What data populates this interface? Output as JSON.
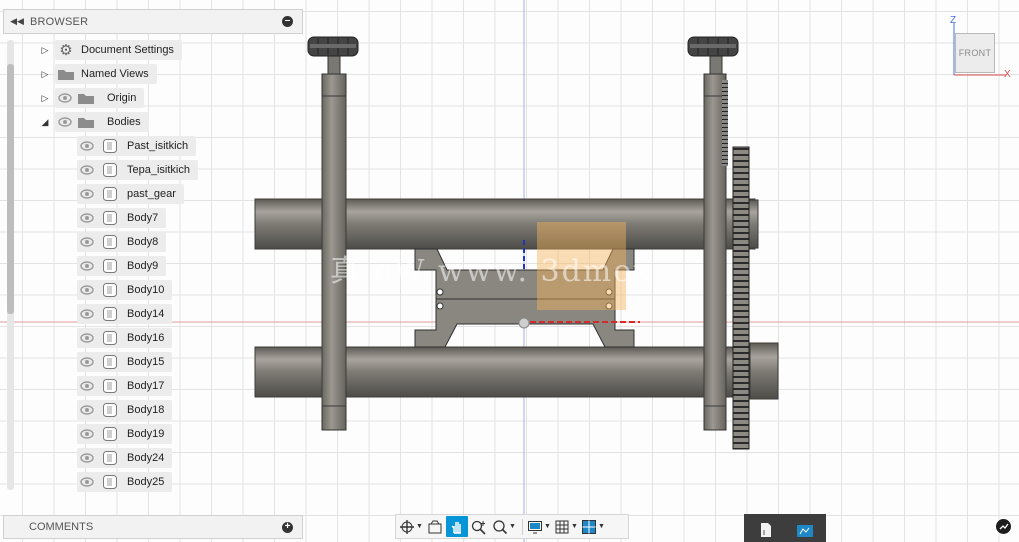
{
  "browser": {
    "title": "BROWSER",
    "items": [
      {
        "label": "Document Settings",
        "expand": "▷",
        "icon": "gear-icon"
      },
      {
        "label": "Named Views",
        "expand": "▷",
        "icon": "folder-icon"
      },
      {
        "label": "Origin",
        "expand": "▷",
        "icon": "folder-icon",
        "visible": true
      },
      {
        "label": "Bodies",
        "expand": "◢",
        "icon": "folder-icon",
        "visible": true
      }
    ],
    "bodies": [
      "Past_isitkich",
      "Tepa_isitkich",
      "past_gear",
      "Body7",
      "Body8",
      "Body9",
      "Body10",
      "Body14",
      "Body16",
      "Body15",
      "Body17",
      "Body18",
      "Body19",
      "Body24",
      "Body25"
    ]
  },
  "comments": {
    "title": "COMMENTS"
  },
  "viewcube": {
    "face": "FRONT",
    "z": "Z",
    "x": "X"
  },
  "watermark": "真  oW www. 3dmox",
  "toolbar": {
    "tools": [
      "orbit-icon",
      "look-at-icon",
      "pan-icon",
      "zoom-window-icon",
      "fit-icon",
      "display-settings-icon",
      "grid-settings-icon",
      "viewports-icon"
    ],
    "active": "pan-icon"
  },
  "colors": {
    "accent": "#0696d7",
    "panel_bg": "#f2f2f2",
    "model_gray": "#7d7a74"
  }
}
